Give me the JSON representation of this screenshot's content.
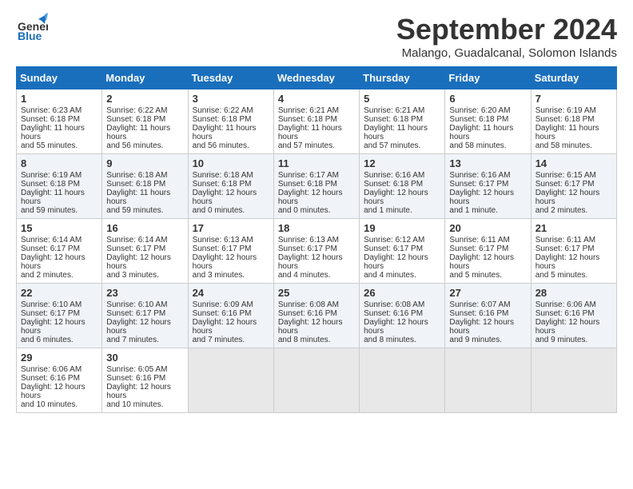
{
  "logo": {
    "line1": "General",
    "line2": "Blue"
  },
  "title": "September 2024",
  "subtitle": "Malango, Guadalcanal, Solomon Islands",
  "days": [
    "Sunday",
    "Monday",
    "Tuesday",
    "Wednesday",
    "Thursday",
    "Friday",
    "Saturday"
  ],
  "weeks": [
    [
      {
        "day": 1,
        "sunrise": "6:23 AM",
        "sunset": "6:18 PM",
        "daylight": "11 hours and 55 minutes."
      },
      {
        "day": 2,
        "sunrise": "6:22 AM",
        "sunset": "6:18 PM",
        "daylight": "11 hours and 56 minutes."
      },
      {
        "day": 3,
        "sunrise": "6:22 AM",
        "sunset": "6:18 PM",
        "daylight": "11 hours and 56 minutes."
      },
      {
        "day": 4,
        "sunrise": "6:21 AM",
        "sunset": "6:18 PM",
        "daylight": "11 hours and 57 minutes."
      },
      {
        "day": 5,
        "sunrise": "6:21 AM",
        "sunset": "6:18 PM",
        "daylight": "11 hours and 57 minutes."
      },
      {
        "day": 6,
        "sunrise": "6:20 AM",
        "sunset": "6:18 PM",
        "daylight": "11 hours and 58 minutes."
      },
      {
        "day": 7,
        "sunrise": "6:19 AM",
        "sunset": "6:18 PM",
        "daylight": "11 hours and 58 minutes."
      }
    ],
    [
      {
        "day": 8,
        "sunrise": "6:19 AM",
        "sunset": "6:18 PM",
        "daylight": "11 hours and 59 minutes."
      },
      {
        "day": 9,
        "sunrise": "6:18 AM",
        "sunset": "6:18 PM",
        "daylight": "11 hours and 59 minutes."
      },
      {
        "day": 10,
        "sunrise": "6:18 AM",
        "sunset": "6:18 PM",
        "daylight": "12 hours and 0 minutes."
      },
      {
        "day": 11,
        "sunrise": "6:17 AM",
        "sunset": "6:18 PM",
        "daylight": "12 hours and 0 minutes."
      },
      {
        "day": 12,
        "sunrise": "6:16 AM",
        "sunset": "6:18 PM",
        "daylight": "12 hours and 1 minute."
      },
      {
        "day": 13,
        "sunrise": "6:16 AM",
        "sunset": "6:17 PM",
        "daylight": "12 hours and 1 minute."
      },
      {
        "day": 14,
        "sunrise": "6:15 AM",
        "sunset": "6:17 PM",
        "daylight": "12 hours and 2 minutes."
      }
    ],
    [
      {
        "day": 15,
        "sunrise": "6:14 AM",
        "sunset": "6:17 PM",
        "daylight": "12 hours and 2 minutes."
      },
      {
        "day": 16,
        "sunrise": "6:14 AM",
        "sunset": "6:17 PM",
        "daylight": "12 hours and 3 minutes."
      },
      {
        "day": 17,
        "sunrise": "6:13 AM",
        "sunset": "6:17 PM",
        "daylight": "12 hours and 3 minutes."
      },
      {
        "day": 18,
        "sunrise": "6:13 AM",
        "sunset": "6:17 PM",
        "daylight": "12 hours and 4 minutes."
      },
      {
        "day": 19,
        "sunrise": "6:12 AM",
        "sunset": "6:17 PM",
        "daylight": "12 hours and 4 minutes."
      },
      {
        "day": 20,
        "sunrise": "6:11 AM",
        "sunset": "6:17 PM",
        "daylight": "12 hours and 5 minutes."
      },
      {
        "day": 21,
        "sunrise": "6:11 AM",
        "sunset": "6:17 PM",
        "daylight": "12 hours and 5 minutes."
      }
    ],
    [
      {
        "day": 22,
        "sunrise": "6:10 AM",
        "sunset": "6:17 PM",
        "daylight": "12 hours and 6 minutes."
      },
      {
        "day": 23,
        "sunrise": "6:10 AM",
        "sunset": "6:17 PM",
        "daylight": "12 hours and 7 minutes."
      },
      {
        "day": 24,
        "sunrise": "6:09 AM",
        "sunset": "6:16 PM",
        "daylight": "12 hours and 7 minutes."
      },
      {
        "day": 25,
        "sunrise": "6:08 AM",
        "sunset": "6:16 PM",
        "daylight": "12 hours and 8 minutes."
      },
      {
        "day": 26,
        "sunrise": "6:08 AM",
        "sunset": "6:16 PM",
        "daylight": "12 hours and 8 minutes."
      },
      {
        "day": 27,
        "sunrise": "6:07 AM",
        "sunset": "6:16 PM",
        "daylight": "12 hours and 9 minutes."
      },
      {
        "day": 28,
        "sunrise": "6:06 AM",
        "sunset": "6:16 PM",
        "daylight": "12 hours and 9 minutes."
      }
    ],
    [
      {
        "day": 29,
        "sunrise": "6:06 AM",
        "sunset": "6:16 PM",
        "daylight": "12 hours and 10 minutes."
      },
      {
        "day": 30,
        "sunrise": "6:05 AM",
        "sunset": "6:16 PM",
        "daylight": "12 hours and 10 minutes."
      },
      null,
      null,
      null,
      null,
      null
    ]
  ]
}
